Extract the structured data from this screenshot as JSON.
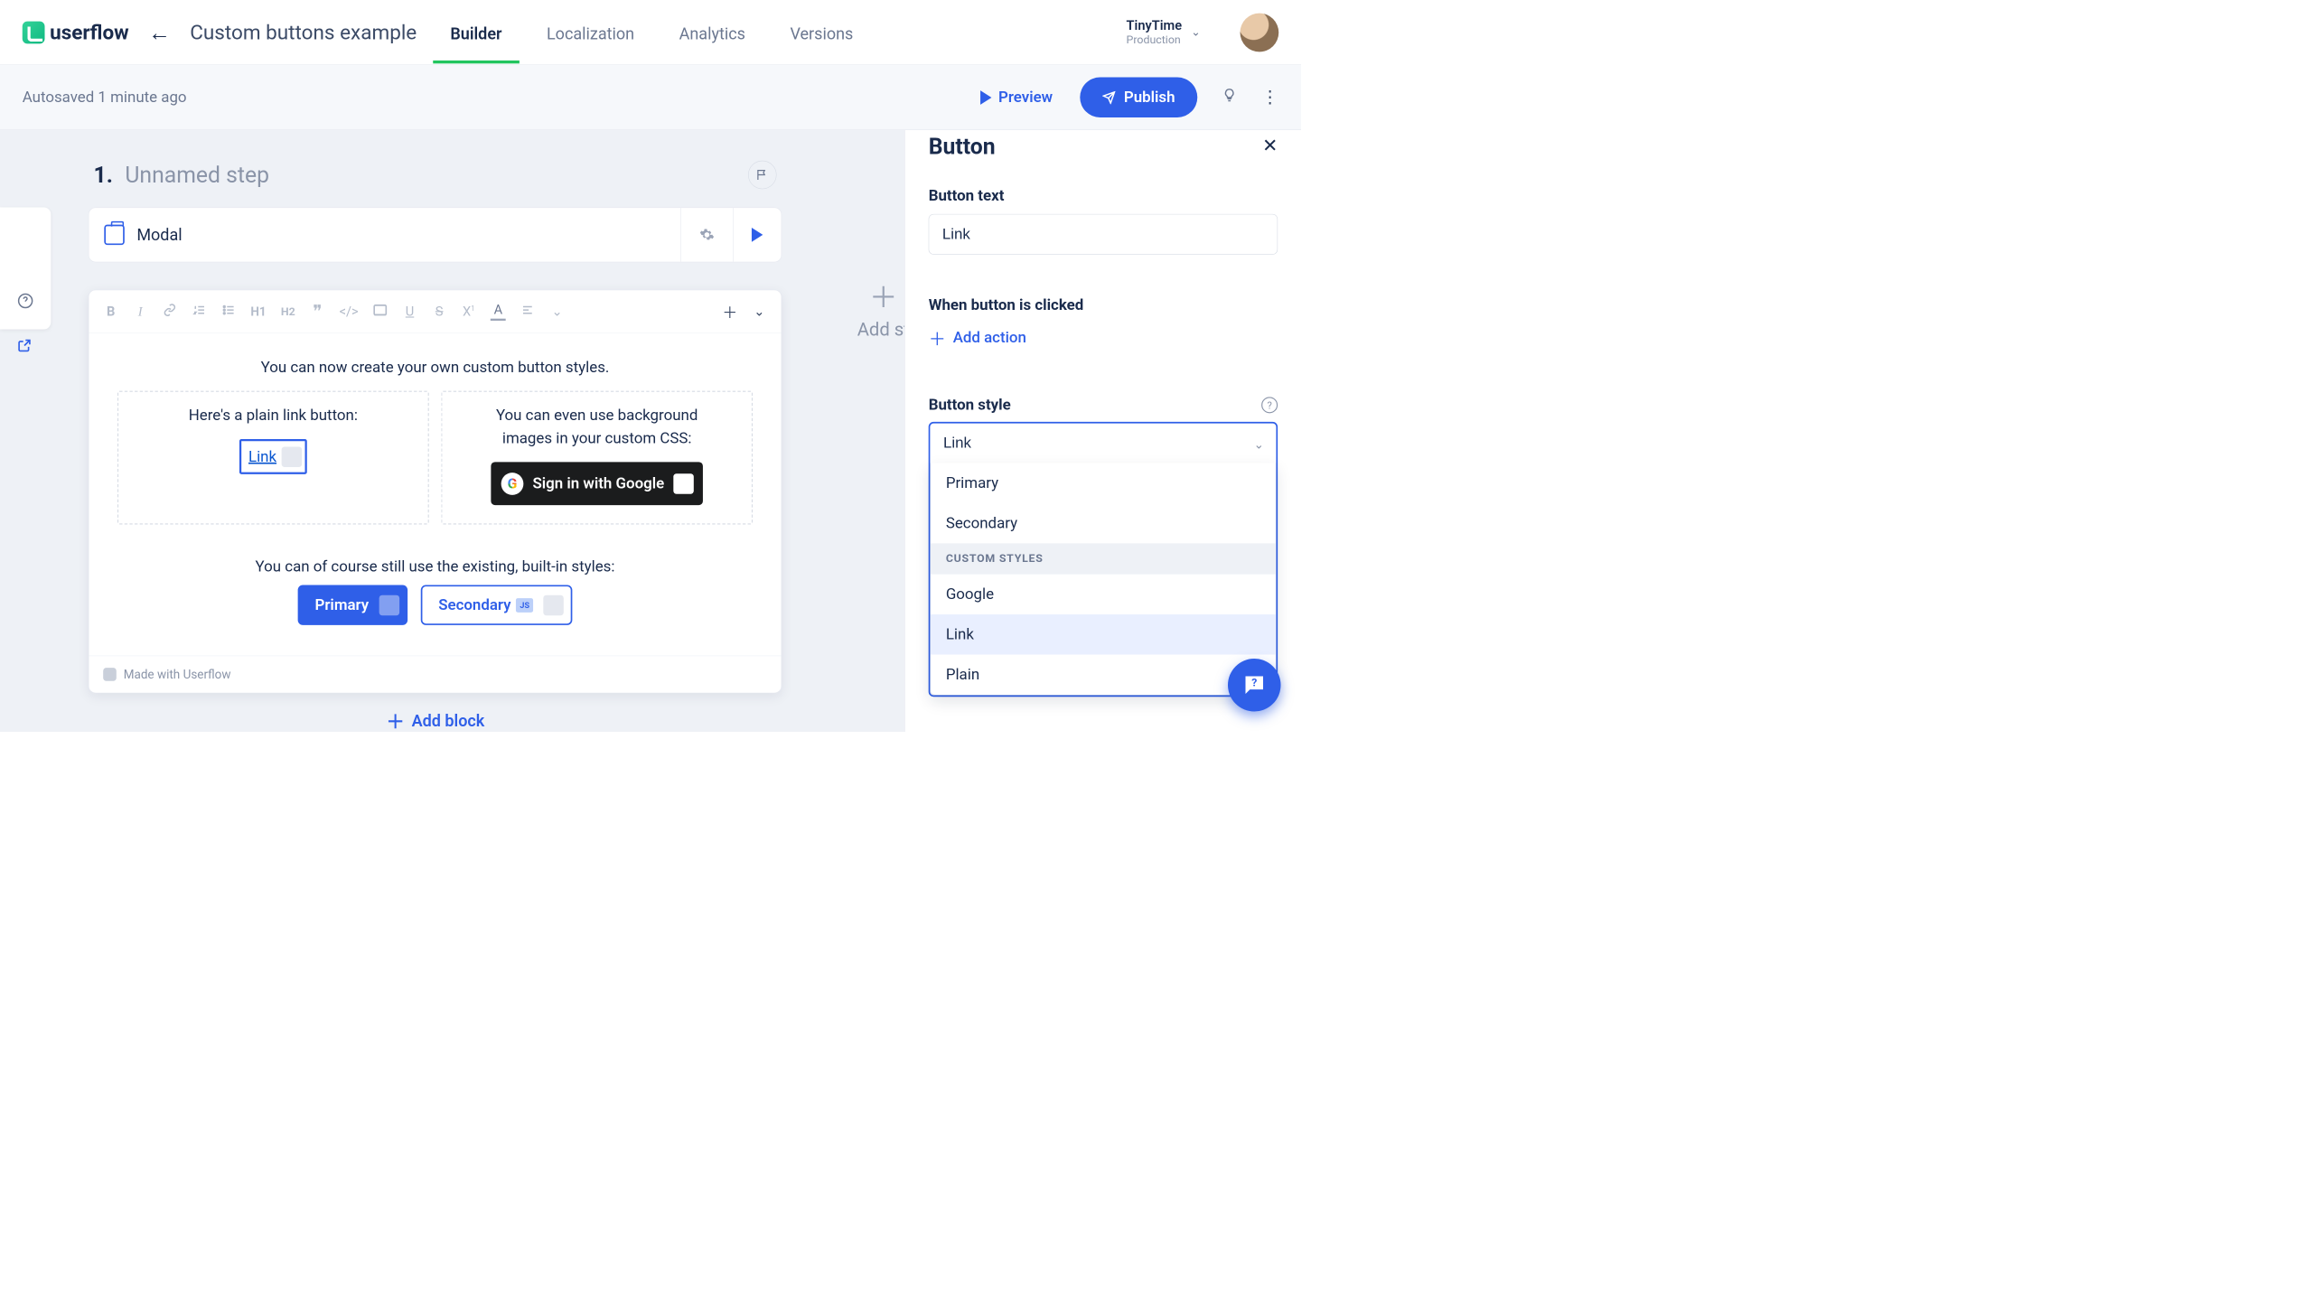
{
  "header": {
    "logo_text": "userflow",
    "page_title": "Custom buttons example",
    "tabs": [
      "Builder",
      "Localization",
      "Analytics",
      "Versions"
    ],
    "active_tab": 0,
    "workspace": {
      "name": "TinyTime",
      "env": "Production"
    }
  },
  "subbar": {
    "autosave": "Autosaved 1 minute ago",
    "preview": "Preview",
    "publish": "Publish"
  },
  "step": {
    "number": "1.",
    "name": "Unnamed step",
    "block_type": "Modal"
  },
  "toolbar_items": [
    "B",
    "I",
    "link",
    "ol",
    "ul",
    "H1",
    "H2",
    "quote",
    "code",
    "image",
    "U",
    "S",
    "sup",
    "A",
    "align",
    "more",
    "plus"
  ],
  "editor": {
    "intro": "You can now create your own custom button styles.",
    "col1_text": "Here's a plain link button:",
    "link_label": "Link",
    "col2_line1": "You can even use background",
    "col2_line2": "images in your custom CSS:",
    "google_label": "Sign in with Google",
    "builtin_text": "You can of course still use the existing, built-in styles:",
    "primary_label": "Primary",
    "secondary_label": "Secondary",
    "js_badge": "JS",
    "made_with": "Made with Userflow",
    "add_block": "Add block"
  },
  "canvas": {
    "add_step": "Add st"
  },
  "panel": {
    "title": "Button",
    "button_text_label": "Button text",
    "button_text_value": "Link",
    "clicked_label": "When button is clicked",
    "add_action": "Add action",
    "style_label": "Button style",
    "style_value": "Link",
    "options": {
      "builtin": [
        "Primary",
        "Secondary"
      ],
      "custom_header": "CUSTOM STYLES",
      "custom": [
        "Google",
        "Link",
        "Plain"
      ],
      "selected": "Link"
    }
  }
}
